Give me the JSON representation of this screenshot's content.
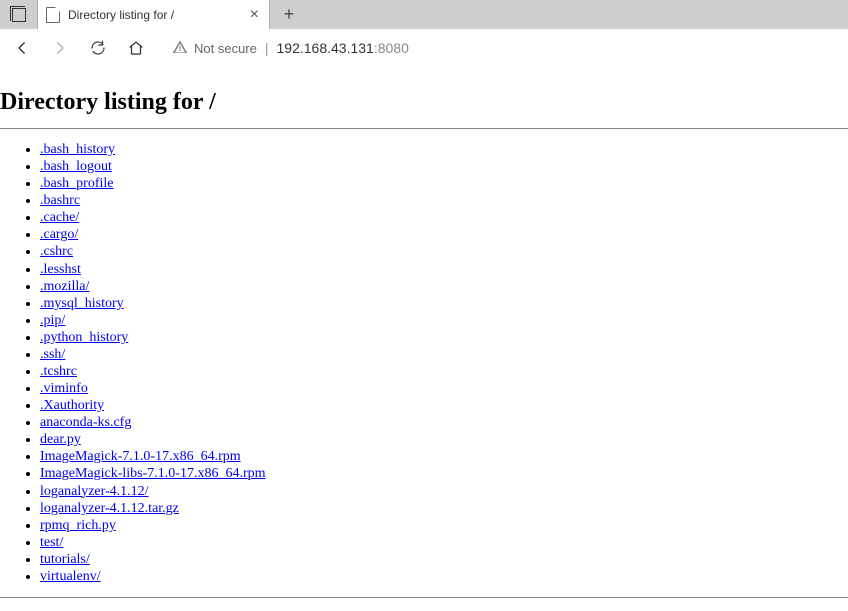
{
  "tab": {
    "title": "Directory listing for /"
  },
  "toolbar": {
    "security_label": "Not secure",
    "url_host": "192.168.43.131",
    "url_port": ":8080"
  },
  "page": {
    "heading": "Directory listing for /",
    "files": [
      ".bash_history",
      ".bash_logout",
      ".bash_profile",
      ".bashrc",
      ".cache/",
      ".cargo/",
      ".cshrc",
      ".lesshst",
      ".mozilla/",
      ".mysql_history",
      ".pip/",
      ".python_history",
      ".ssh/",
      ".tcshrc",
      ".viminfo",
      ".Xauthority",
      "anaconda-ks.cfg",
      "dear.py",
      "ImageMagick-7.1.0-17.x86_64.rpm",
      "ImageMagick-libs-7.1.0-17.x86_64.rpm",
      "loganalyzer-4.1.12/",
      "loganalyzer-4.1.12.tar.gz",
      "rpmq_rich.py",
      "test/",
      "tutorials/",
      "virtualenv/"
    ]
  }
}
